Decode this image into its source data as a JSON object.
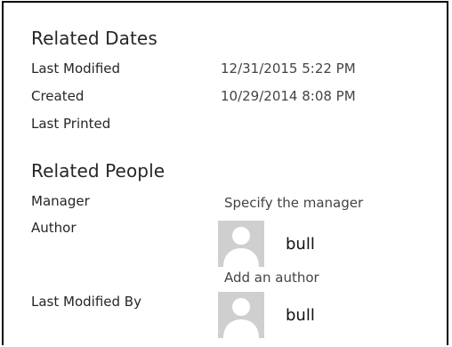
{
  "related_dates": {
    "heading": "Related Dates",
    "rows": [
      {
        "label": "Last Modified",
        "value": "12/31/2015 5:22 PM"
      },
      {
        "label": "Created",
        "value": "10/29/2014 8:08 PM"
      },
      {
        "label": "Last Printed",
        "value": ""
      }
    ]
  },
  "related_people": {
    "heading": "Related People",
    "manager": {
      "label": "Manager",
      "placeholder": "Specify the manager"
    },
    "author": {
      "label": "Author",
      "name": "bull",
      "avatar_icon": "person-silhouette-icon",
      "add_label": "Add an author"
    },
    "last_modified_by": {
      "label": "Last Modified By",
      "name": "bull",
      "avatar_icon": "person-silhouette-icon"
    }
  },
  "colors": {
    "border": "#000000",
    "avatar_bg": "#cfcfcf",
    "avatar_fg": "#ffffff"
  }
}
